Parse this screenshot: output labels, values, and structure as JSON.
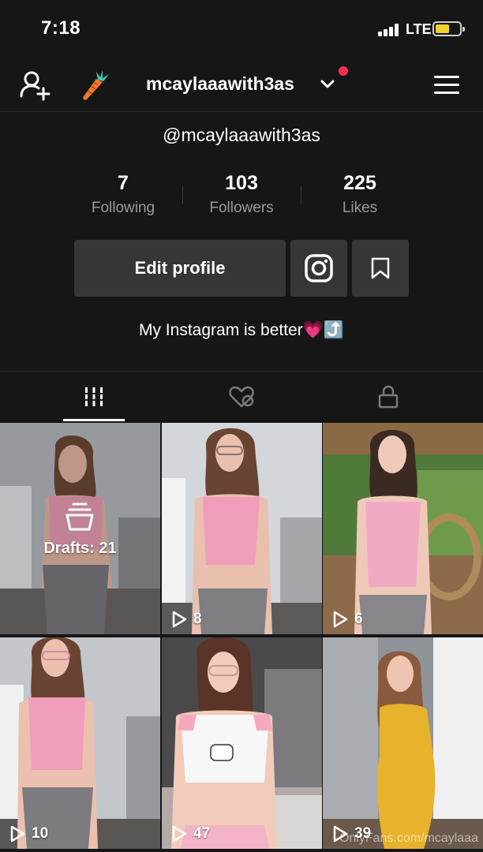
{
  "status_bar": {
    "time": "7:18",
    "network": "LTE"
  },
  "nav": {
    "username": "mcaylaaawith3as"
  },
  "profile": {
    "handle": "@mcaylaaawith3as",
    "stats": [
      {
        "value": "7",
        "label": "Following"
      },
      {
        "value": "103",
        "label": "Followers"
      },
      {
        "value": "225",
        "label": "Likes"
      }
    ],
    "edit_label": "Edit profile",
    "bio": "My Instagram is better💗⤴️"
  },
  "tabs": [
    {
      "icon": "grid-bars-icon",
      "active": true
    },
    {
      "icon": "liked-heart-icon",
      "active": false
    },
    {
      "icon": "lock-icon",
      "active": false
    }
  ],
  "videos": [
    {
      "drafts": "Drafts: 21"
    },
    {
      "views": "8"
    },
    {
      "views": "6"
    },
    {
      "views": "10"
    },
    {
      "views": "47"
    },
    {
      "views": "39"
    }
  ],
  "watermark": "OnlyFans.com/mcaylaaa",
  "colors": {
    "background": "#161616",
    "button": "#363636",
    "accent_dot": "#fe2c55",
    "battery": "#f2d22c"
  }
}
